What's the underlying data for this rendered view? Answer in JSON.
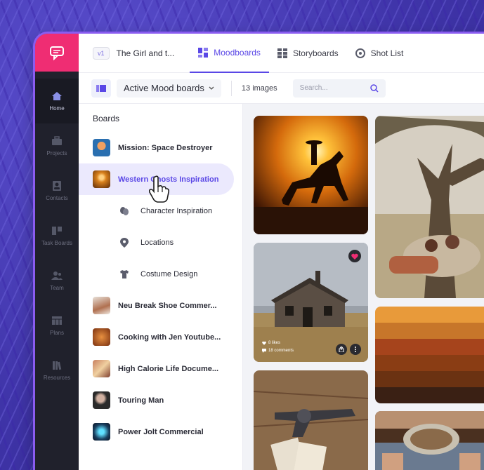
{
  "topbar": {
    "version": "v1",
    "project_title": "The Girl and t...",
    "tabs": [
      {
        "label": "Moodboards",
        "active": true
      },
      {
        "label": "Storyboards",
        "active": false
      },
      {
        "label": "Shot List",
        "active": false
      }
    ]
  },
  "toolbar": {
    "board_selector": "Active Mood boards",
    "image_count": "13 images",
    "search_placeholder": "Search..."
  },
  "nav": {
    "items": [
      {
        "label": "Home",
        "icon": "home-icon",
        "active": true
      },
      {
        "label": "Projects",
        "icon": "briefcase-icon",
        "active": false
      },
      {
        "label": "Contacts",
        "icon": "contact-card-icon",
        "active": false
      },
      {
        "label": "Task Boards",
        "icon": "task-board-icon",
        "active": false
      },
      {
        "label": "Team",
        "icon": "team-icon",
        "active": false
      },
      {
        "label": "Plans",
        "icon": "plans-icon",
        "active": false
      },
      {
        "label": "Resources",
        "icon": "resources-icon",
        "active": false
      }
    ]
  },
  "boards": {
    "heading": "Boards",
    "items": [
      {
        "label": "Mission: Space Destroyer",
        "level": 0,
        "active": false
      },
      {
        "label": "Western Ghosts Inspiration",
        "level": 0,
        "active": true
      },
      {
        "label": "Character Inspiration",
        "level": 1,
        "icon": "masks-icon"
      },
      {
        "label": "Locations",
        "level": 1,
        "icon": "location-pin-icon"
      },
      {
        "label": "Costume Design",
        "level": 1,
        "icon": "shirt-icon"
      },
      {
        "label": "Neu Break Shoe Commer...",
        "level": 0,
        "active": false
      },
      {
        "label": "Cooking with Jen Youtube...",
        "level": 0,
        "active": false
      },
      {
        "label": "High Calorie Life Docume...",
        "level": 0,
        "active": false
      },
      {
        "label": "Touring Man",
        "level": 0,
        "active": false
      },
      {
        "label": "Power Jolt Commercial",
        "level": 0,
        "active": false
      }
    ]
  },
  "grid": {
    "house_card": {
      "likes": "8 likes",
      "comments": "18 comments"
    },
    "palette": [
      "#e89a3a",
      "#c7762a",
      "#a6441c",
      "#8a3d14",
      "#6b3212",
      "#3a2014"
    ]
  },
  "colors": {
    "accent": "#5a47e6",
    "brand": "#ef2d73",
    "nav_bg": "#20212c"
  }
}
